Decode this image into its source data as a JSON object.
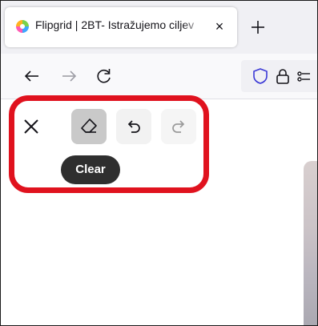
{
  "browser": {
    "tab": {
      "title": "Flipgrid | 2BT- Istražujemo ciljev",
      "close_glyph": "×"
    },
    "newtab_glyph": "+"
  },
  "toolbar": {
    "tooltip": "Clear"
  },
  "colors": {
    "highlight_border": "#e0121e",
    "tooltip_bg": "#2f2f2f",
    "active_tool_bg": "#c9c9c9"
  }
}
